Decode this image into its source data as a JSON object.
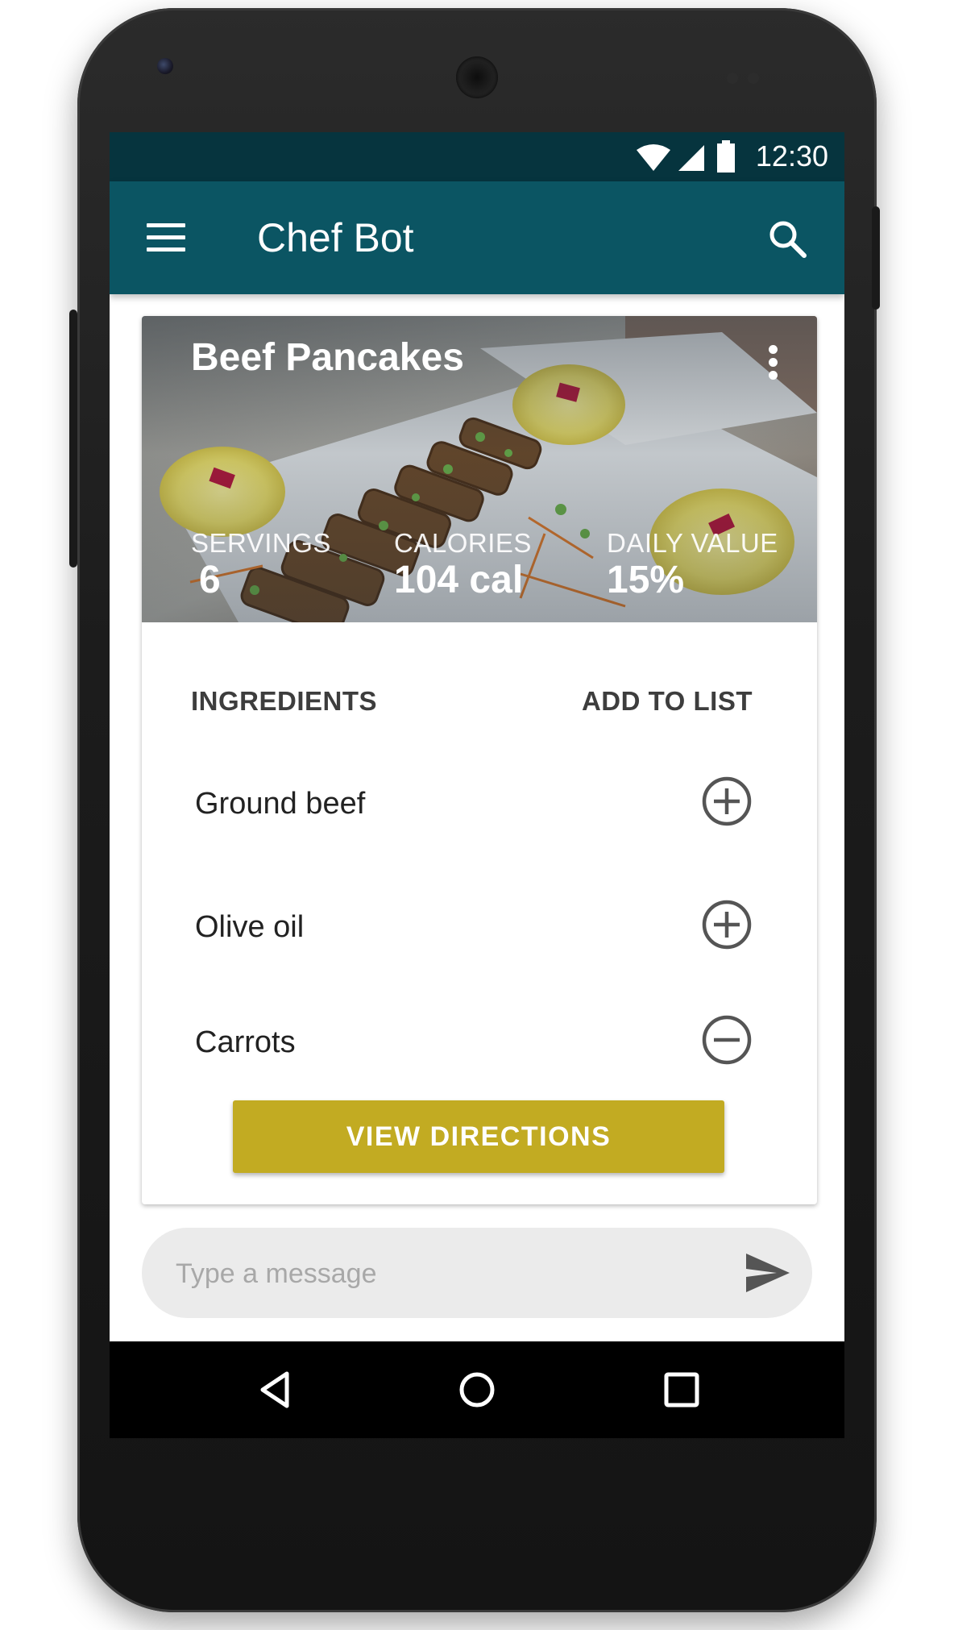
{
  "status_bar": {
    "time": "12:30"
  },
  "app_bar": {
    "title": "Chef Bot"
  },
  "recipe": {
    "title": "Beef Pancakes",
    "stats": [
      {
        "label": "SERVINGS",
        "value": "6"
      },
      {
        "label": "CALORIES",
        "value": "104 cal"
      },
      {
        "label": "DAILY VALUE",
        "value": "15%"
      }
    ],
    "ingredients_header": "INGREDIENTS",
    "add_to_list_header": "ADD TO LIST",
    "ingredients": [
      {
        "name": "Ground beef",
        "action_icon": "add-circle-icon"
      },
      {
        "name": "Olive oil",
        "action_icon": "add-circle-icon"
      },
      {
        "name": "Carrots",
        "action_icon": "remove-circle-icon"
      }
    ],
    "directions_button": "VIEW DIRECTIONS"
  },
  "message_bar": {
    "placeholder": "Type a message",
    "send_icon": "send-icon"
  },
  "nav_bar": {
    "icons": [
      "back-icon",
      "home-icon",
      "recents-icon"
    ]
  },
  "colors": {
    "status_bar": "#06343e",
    "app_bar": "#0b5563",
    "accent_button": "#c2ab22"
  }
}
